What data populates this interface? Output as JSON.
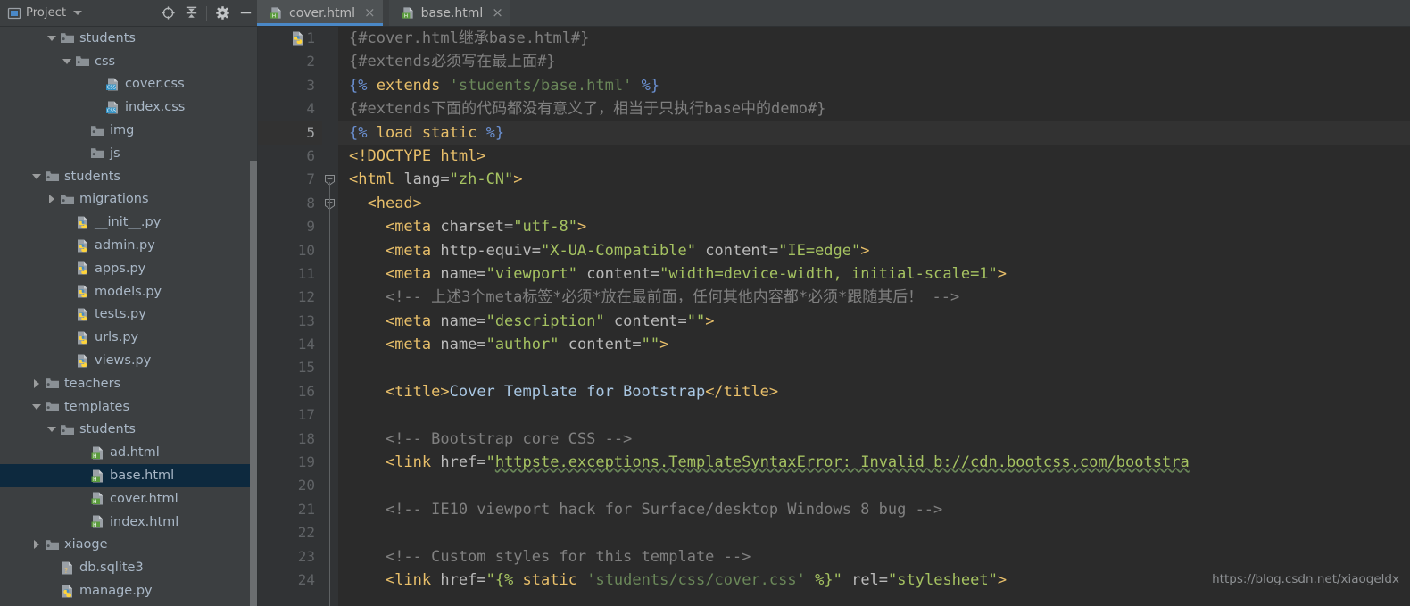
{
  "window": {
    "tool_window_title": "Project",
    "tool_window_icon": "project-window-icon",
    "toolbar_icons": [
      "locate-target-icon",
      "collapse-all-icon",
      "settings-gear-icon",
      "hide-minimize-icon"
    ]
  },
  "tabs": [
    {
      "label": "cover.html",
      "icon": "html-file-icon",
      "close": "×",
      "active": true
    },
    {
      "label": "base.html",
      "icon": "html-file-icon",
      "close": "×",
      "active": false
    }
  ],
  "tree": [
    {
      "label": "students",
      "icon": "folder-icon",
      "twisty": "down",
      "indent": 3,
      "selected": false
    },
    {
      "label": "css",
      "icon": "folder-icon",
      "twisty": "down",
      "indent": 4,
      "selected": false
    },
    {
      "label": "cover.css",
      "icon": "css-file-icon",
      "twisty": "none",
      "indent": 6,
      "selected": false
    },
    {
      "label": "index.css",
      "icon": "css-file-icon",
      "twisty": "none",
      "indent": 6,
      "selected": false
    },
    {
      "label": "img",
      "icon": "folder-icon",
      "twisty": "none",
      "indent": 5,
      "selected": false
    },
    {
      "label": "js",
      "icon": "folder-icon",
      "twisty": "none",
      "indent": 5,
      "selected": false
    },
    {
      "label": "students",
      "icon": "folder-icon",
      "twisty": "down",
      "indent": 2,
      "selected": false
    },
    {
      "label": "migrations",
      "icon": "folder-icon",
      "twisty": "right",
      "indent": 3,
      "selected": false
    },
    {
      "label": "__init__.py",
      "icon": "python-file-icon",
      "twisty": "none",
      "indent": 4,
      "selected": false
    },
    {
      "label": "admin.py",
      "icon": "python-file-icon",
      "twisty": "none",
      "indent": 4,
      "selected": false
    },
    {
      "label": "apps.py",
      "icon": "python-file-icon",
      "twisty": "none",
      "indent": 4,
      "selected": false
    },
    {
      "label": "models.py",
      "icon": "python-file-icon",
      "twisty": "none",
      "indent": 4,
      "selected": false
    },
    {
      "label": "tests.py",
      "icon": "python-file-icon",
      "twisty": "none",
      "indent": 4,
      "selected": false
    },
    {
      "label": "urls.py",
      "icon": "python-file-icon",
      "twisty": "none",
      "indent": 4,
      "selected": false
    },
    {
      "label": "views.py",
      "icon": "python-file-icon",
      "twisty": "none",
      "indent": 4,
      "selected": false
    },
    {
      "label": "teachers",
      "icon": "folder-icon",
      "twisty": "right",
      "indent": 2,
      "selected": false
    },
    {
      "label": "templates",
      "icon": "folder-icon",
      "twisty": "down",
      "indent": 2,
      "selected": false
    },
    {
      "label": "students",
      "icon": "folder-icon",
      "twisty": "down",
      "indent": 3,
      "selected": false
    },
    {
      "label": "ad.html",
      "icon": "html-file-icon",
      "twisty": "none",
      "indent": 5,
      "selected": false
    },
    {
      "label": "base.html",
      "icon": "html-file-icon",
      "twisty": "none",
      "indent": 5,
      "selected": true
    },
    {
      "label": "cover.html",
      "icon": "html-file-icon",
      "twisty": "none",
      "indent": 5,
      "selected": false
    },
    {
      "label": "index.html",
      "icon": "html-file-icon",
      "twisty": "none",
      "indent": 5,
      "selected": false
    },
    {
      "label": "xiaoge",
      "icon": "folder-icon",
      "twisty": "right",
      "indent": 2,
      "selected": false
    },
    {
      "label": "db.sqlite3",
      "icon": "unknown-file-icon",
      "twisty": "none",
      "indent": 3,
      "selected": false
    },
    {
      "label": "manage.py",
      "icon": "python-file-icon",
      "twisty": "none",
      "indent": 3,
      "selected": false
    }
  ],
  "editor": {
    "filename": "cover.html",
    "gutter_icon": "python-file-icon",
    "current_line": 5,
    "lines": [
      {
        "n": 1,
        "fold": "none",
        "tokens": [
          {
            "t": "{#cover.html继承base.html#}",
            "c": "t-comment"
          }
        ]
      },
      {
        "n": 2,
        "fold": "none",
        "tokens": [
          {
            "t": "{#extends必须写在最上面#}",
            "c": "t-comment"
          }
        ]
      },
      {
        "n": 3,
        "fold": "none",
        "tokens": [
          {
            "t": "{%",
            "c": "t-djtag"
          },
          {
            "t": " ",
            "c": "t-plain"
          },
          {
            "t": "extends",
            "c": "t-djkw"
          },
          {
            "t": " ",
            "c": "t-plain"
          },
          {
            "t": "'students/base.html'",
            "c": "t-str"
          },
          {
            "t": " ",
            "c": "t-plain"
          },
          {
            "t": "%}",
            "c": "t-djtag"
          }
        ]
      },
      {
        "n": 4,
        "fold": "none",
        "tokens": [
          {
            "t": "{#extends下面的代码都没有意义了，相当于只执行base中的demo#}",
            "c": "t-comment"
          }
        ]
      },
      {
        "n": 5,
        "fold": "none",
        "tokens": [
          {
            "t": "{%",
            "c": "t-djtag"
          },
          {
            "t": " ",
            "c": "t-plain"
          },
          {
            "t": "load static",
            "c": "t-djkw"
          },
          {
            "t": " ",
            "c": "t-plain"
          },
          {
            "t": "%}",
            "c": "t-djtag"
          }
        ]
      },
      {
        "n": 6,
        "fold": "none",
        "tokens": [
          {
            "t": "<!DOCTYPE html>",
            "c": "t-doctype"
          }
        ]
      },
      {
        "n": 7,
        "fold": "minus",
        "tokens": [
          {
            "t": "<html",
            "c": "t-tag"
          },
          {
            "t": " ",
            "c": "t-plain"
          },
          {
            "t": "lang=",
            "c": "t-attr"
          },
          {
            "t": "\"zh-CN\"",
            "c": "t-val"
          },
          {
            "t": ">",
            "c": "t-tag"
          }
        ]
      },
      {
        "n": 8,
        "fold": "minus",
        "tokens": [
          {
            "t": "  ",
            "c": "t-plain"
          },
          {
            "t": "<head>",
            "c": "t-tag"
          }
        ]
      },
      {
        "n": 9,
        "fold": "line",
        "tokens": [
          {
            "t": "    ",
            "c": "t-plain"
          },
          {
            "t": "<meta",
            "c": "t-tag"
          },
          {
            "t": " ",
            "c": "t-plain"
          },
          {
            "t": "charset=",
            "c": "t-attr"
          },
          {
            "t": "\"utf-8\"",
            "c": "t-val"
          },
          {
            "t": ">",
            "c": "t-tag"
          }
        ]
      },
      {
        "n": 10,
        "fold": "line",
        "tokens": [
          {
            "t": "    ",
            "c": "t-plain"
          },
          {
            "t": "<meta",
            "c": "t-tag"
          },
          {
            "t": " ",
            "c": "t-plain"
          },
          {
            "t": "http-equiv=",
            "c": "t-attr"
          },
          {
            "t": "\"X-UA-Compatible\"",
            "c": "t-val"
          },
          {
            "t": " ",
            "c": "t-plain"
          },
          {
            "t": "content=",
            "c": "t-attr"
          },
          {
            "t": "\"IE=edge\"",
            "c": "t-val"
          },
          {
            "t": ">",
            "c": "t-tag"
          }
        ]
      },
      {
        "n": 11,
        "fold": "line",
        "tokens": [
          {
            "t": "    ",
            "c": "t-plain"
          },
          {
            "t": "<meta",
            "c": "t-tag"
          },
          {
            "t": " ",
            "c": "t-plain"
          },
          {
            "t": "name=",
            "c": "t-attr"
          },
          {
            "t": "\"viewport\"",
            "c": "t-val"
          },
          {
            "t": " ",
            "c": "t-plain"
          },
          {
            "t": "content=",
            "c": "t-attr"
          },
          {
            "t": "\"width=device-width, initial-scale=1\"",
            "c": "t-val"
          },
          {
            "t": ">",
            "c": "t-tag"
          }
        ]
      },
      {
        "n": 12,
        "fold": "line",
        "tokens": [
          {
            "t": "    ",
            "c": "t-plain"
          },
          {
            "t": "<!-- 上述3个meta标签*必须*放在最前面，任何其他内容都*必须*跟随其后！ -->",
            "c": "t-comment"
          }
        ]
      },
      {
        "n": 13,
        "fold": "line",
        "tokens": [
          {
            "t": "    ",
            "c": "t-plain"
          },
          {
            "t": "<meta",
            "c": "t-tag"
          },
          {
            "t": " ",
            "c": "t-plain"
          },
          {
            "t": "name=",
            "c": "t-attr"
          },
          {
            "t": "\"description\"",
            "c": "t-val"
          },
          {
            "t": " ",
            "c": "t-plain"
          },
          {
            "t": "content=",
            "c": "t-attr"
          },
          {
            "t": "\"\"",
            "c": "t-val"
          },
          {
            "t": ">",
            "c": "t-tag"
          }
        ]
      },
      {
        "n": 14,
        "fold": "line",
        "tokens": [
          {
            "t": "    ",
            "c": "t-plain"
          },
          {
            "t": "<meta",
            "c": "t-tag"
          },
          {
            "t": " ",
            "c": "t-plain"
          },
          {
            "t": "name=",
            "c": "t-attr"
          },
          {
            "t": "\"author\"",
            "c": "t-val"
          },
          {
            "t": " ",
            "c": "t-plain"
          },
          {
            "t": "content=",
            "c": "t-attr"
          },
          {
            "t": "\"\"",
            "c": "t-val"
          },
          {
            "t": ">",
            "c": "t-tag"
          }
        ]
      },
      {
        "n": 15,
        "fold": "line",
        "tokens": []
      },
      {
        "n": 16,
        "fold": "line",
        "tokens": [
          {
            "t": "    ",
            "c": "t-plain"
          },
          {
            "t": "<title>",
            "c": "t-tag"
          },
          {
            "t": "Cover Template for Bootstrap",
            "c": "t-text"
          },
          {
            "t": "</title>",
            "c": "t-tag"
          }
        ]
      },
      {
        "n": 17,
        "fold": "line",
        "tokens": []
      },
      {
        "n": 18,
        "fold": "line",
        "tokens": [
          {
            "t": "    ",
            "c": "t-plain"
          },
          {
            "t": "<!-- Bootstrap core CSS -->",
            "c": "t-comment"
          }
        ]
      },
      {
        "n": 19,
        "fold": "line",
        "tokens": [
          {
            "t": "    ",
            "c": "t-plain"
          },
          {
            "t": "<link",
            "c": "t-tag"
          },
          {
            "t": " ",
            "c": "t-plain"
          },
          {
            "t": "href=",
            "c": "t-attr"
          },
          {
            "t": "\"",
            "c": "t-val"
          },
          {
            "t": "httpste.exceptions.TemplateSyntaxError: Invalid b://cdn.bootcss.com/bootstra",
            "c": "t-val"
          }
        ]
      },
      {
        "n": 20,
        "fold": "line",
        "tokens": []
      },
      {
        "n": 21,
        "fold": "line",
        "tokens": [
          {
            "t": "    ",
            "c": "t-plain"
          },
          {
            "t": "<!-- IE10 viewport hack for Surface/desktop Windows 8 bug -->",
            "c": "t-comment"
          }
        ]
      },
      {
        "n": 22,
        "fold": "line",
        "tokens": []
      },
      {
        "n": 23,
        "fold": "line",
        "tokens": [
          {
            "t": "    ",
            "c": "t-plain"
          },
          {
            "t": "<!-- Custom styles for this template -->",
            "c": "t-comment"
          }
        ]
      },
      {
        "n": 24,
        "fold": "line",
        "tokens": [
          {
            "t": "    ",
            "c": "t-plain"
          },
          {
            "t": "<link",
            "c": "t-tag"
          },
          {
            "t": " ",
            "c": "t-plain"
          },
          {
            "t": "href=",
            "c": "t-attr"
          },
          {
            "t": "\"{%",
            "c": "t-val"
          },
          {
            "t": " ",
            "c": "t-plain"
          },
          {
            "t": "static",
            "c": "t-djkw"
          },
          {
            "t": " ",
            "c": "t-plain"
          },
          {
            "t": "'students/css/cover.css'",
            "c": "t-str"
          },
          {
            "t": " ",
            "c": "t-plain"
          },
          {
            "t": "%}\"",
            "c": "t-val"
          },
          {
            "t": " ",
            "c": "t-plain"
          },
          {
            "t": "rel=",
            "c": "t-attr"
          },
          {
            "t": "\"stylesheet\"",
            "c": "t-val"
          },
          {
            "t": ">",
            "c": "t-tag"
          }
        ]
      }
    ]
  },
  "watermark": "https://blog.csdn.net/xiaogeldx",
  "colors": {
    "tab_accent": "#4a88c7",
    "tree_selection": "#0d293e",
    "editor_bg": "#2b2b2b",
    "panel_bg": "#3c3f41",
    "gutter_bg": "#313335"
  }
}
